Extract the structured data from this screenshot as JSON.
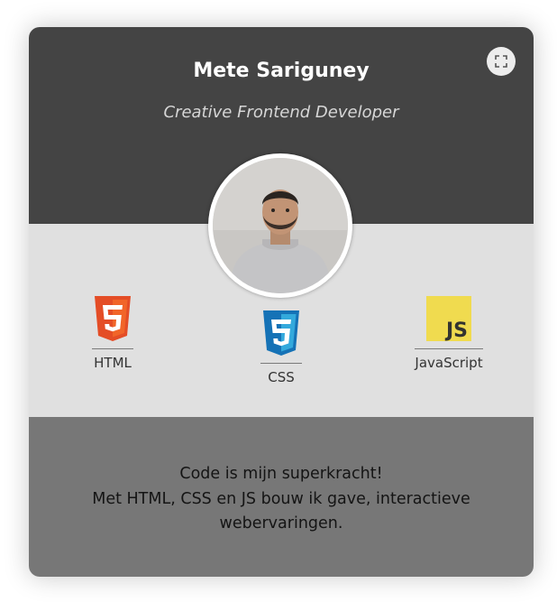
{
  "profile": {
    "name": "Mete Sariguney",
    "role": "Creative Frontend Developer"
  },
  "controls": {
    "expand_icon": "expand-icon"
  },
  "skills": [
    {
      "label": "HTML",
      "icon": "html5-icon",
      "color": "#e44d26"
    },
    {
      "label": "CSS",
      "icon": "css3-icon",
      "color": "#1572b6"
    },
    {
      "label": "JavaScript",
      "icon": "js-icon",
      "color": "#f0db4f"
    }
  ],
  "bio": {
    "line1": "Code is mijn superkracht!",
    "line2": "Met HTML, CSS en JS bouw ik gave, interactieve",
    "line3": "webervaringen."
  },
  "colors": {
    "header_bg": "#444444",
    "skills_bg": "#e0e0e0",
    "footer_bg": "#777777"
  }
}
